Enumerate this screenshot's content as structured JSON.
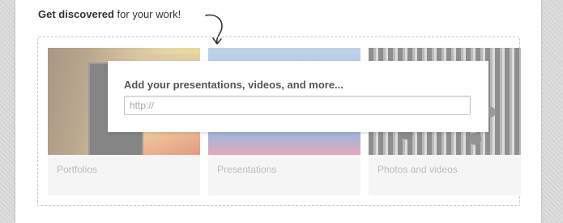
{
  "header": {
    "emphasis": "Get discovered",
    "rest": " for your work!"
  },
  "overlay": {
    "title": "Add your presentations, videos, and more...",
    "url_placeholder": "http://"
  },
  "tiles": [
    {
      "caption": "Portfolios"
    },
    {
      "caption": "Presentations"
    },
    {
      "caption": "Photos and videos"
    }
  ],
  "icons": {
    "arrow": "curved-arrow-down-icon"
  },
  "colors": {
    "card_background": "#ffffff",
    "page_background": "#d9d9d9",
    "tile_background": "#f5f5f5",
    "caption_text": "#bdbdbd",
    "heading_text": "#333333"
  }
}
